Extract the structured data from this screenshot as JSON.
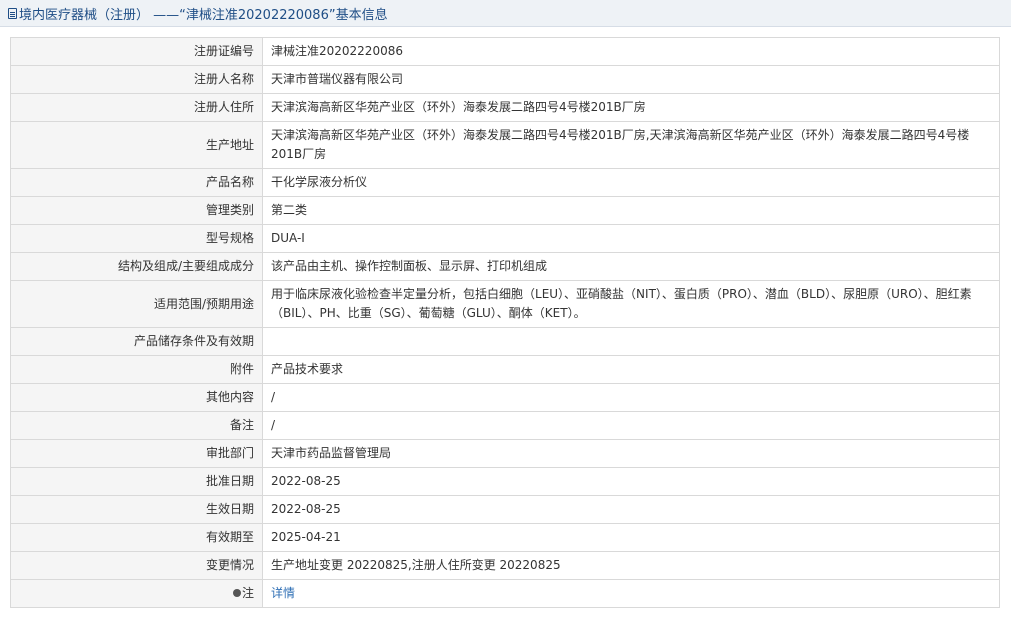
{
  "header": {
    "title": "境内医疗器械（注册） ——“津械注准20202220086”基本信息"
  },
  "rows": [
    {
      "label": "注册证编号",
      "value": "津械注准20202220086"
    },
    {
      "label": "注册人名称",
      "value": "天津市普瑞仪器有限公司"
    },
    {
      "label": "注册人住所",
      "value": "天津滨海高新区华苑产业区（环外）海泰发展二路四号4号楼201B厂房"
    },
    {
      "label": "生产地址",
      "value": "天津滨海高新区华苑产业区（环外）海泰发展二路四号4号楼201B厂房,天津滨海高新区华苑产业区（环外）海泰发展二路四号4号楼201B厂房"
    },
    {
      "label": "产品名称",
      "value": "干化学尿液分析仪"
    },
    {
      "label": "管理类别",
      "value": "第二类"
    },
    {
      "label": "型号规格",
      "value": "DUA-I"
    },
    {
      "label": "结构及组成/主要组成成分",
      "value": "该产品由主机、操作控制面板、显示屏、打印机组成"
    },
    {
      "label": "适用范围/预期用途",
      "value": "用于临床尿液化验检查半定量分析，包括白细胞（LEU）、亚硝酸盐（NIT）、蛋白质（PRO）、潜血（BLD）、尿胆原（URO）、胆红素（BIL）、PH、比重（SG）、葡萄糖（GLU）、酮体（KET）。"
    },
    {
      "label": "产品储存条件及有效期",
      "value": ""
    },
    {
      "label": "附件",
      "value": "产品技术要求"
    },
    {
      "label": "其他内容",
      "value": "/"
    },
    {
      "label": "备注",
      "value": "/"
    },
    {
      "label": "审批部门",
      "value": "天津市药品监督管理局"
    },
    {
      "label": "批准日期",
      "value": "2022-08-25"
    },
    {
      "label": "生效日期",
      "value": "2022-08-25"
    },
    {
      "label": "有效期至",
      "value": "2025-04-21"
    },
    {
      "label": "变更情况",
      "value": "生产地址变更 20220825,注册人住所变更 20220825"
    }
  ],
  "note": {
    "label": "注",
    "icon": "note-icon",
    "link_text": "详情"
  }
}
